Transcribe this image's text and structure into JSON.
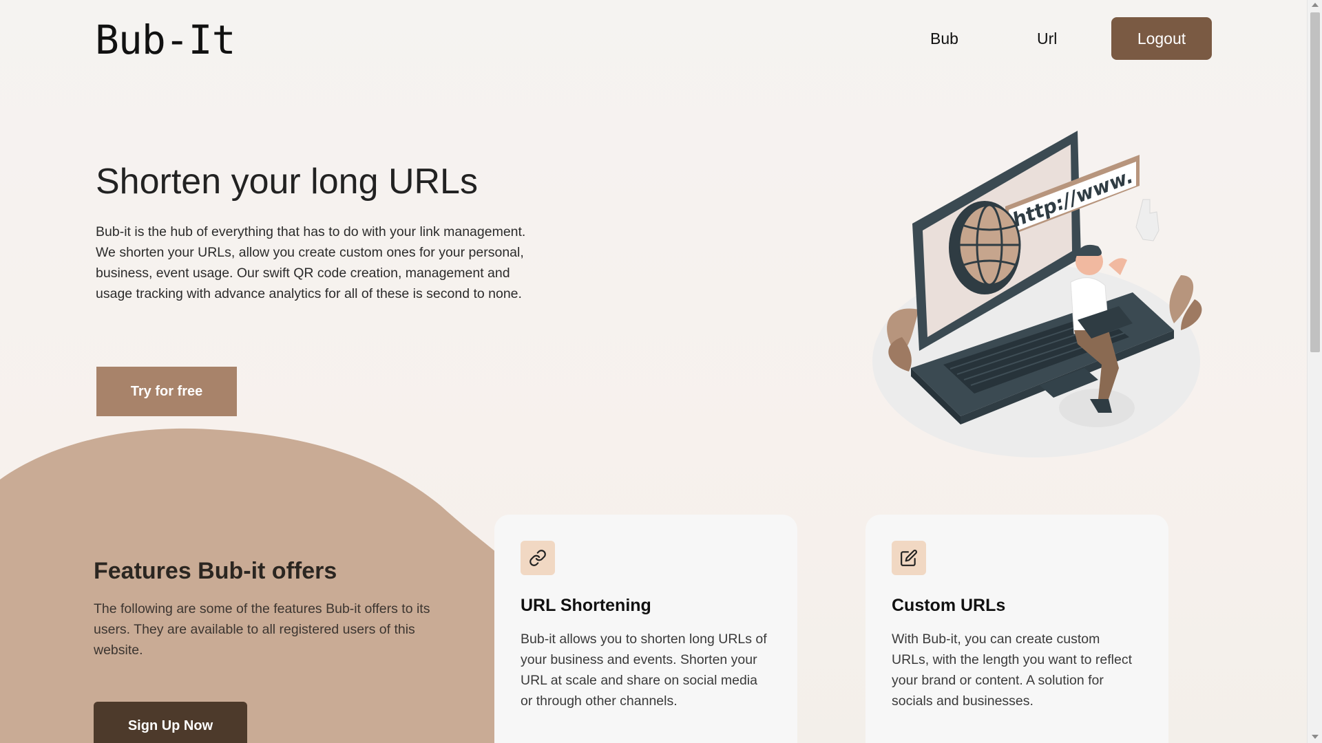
{
  "header": {
    "logo": "Bub-It",
    "nav": [
      {
        "label": "Bub"
      },
      {
        "label": "Url"
      }
    ],
    "logout_label": "Logout"
  },
  "hero": {
    "title": "Shorten your long URLs",
    "description": "Bub-it is the hub of everything that has to do with your link management. We shorten your URLs, allow you create custom ones for your personal, business, event usage. Our swift QR code creation, management and usage tracking with advance analytics for all of these is second to none.",
    "cta_label": "Try for free",
    "illustration_text": "http://www."
  },
  "features": {
    "title": "Features Bub-it offers",
    "description": "The following are some of the features Bub-it offers to its users. They are available to all registered users of this website.",
    "signup_label": "Sign Up Now",
    "cards": [
      {
        "icon": "link-icon",
        "title": "URL Shortening",
        "text": "Bub-it allows you to shorten long URLs of your business and events. Shorten your URL at scale and share on social media or through other channels."
      },
      {
        "icon": "edit-icon",
        "title": "Custom URLs",
        "text": "With Bub-it, you can create custom URLs, with the length you want to reflect your brand or content. A solution for socials and businesses."
      }
    ]
  },
  "colors": {
    "accent_dark": "#7a5a43",
    "accent_light": "#a8836a",
    "blob": "#c9ab95",
    "icon_bg": "#f1d8c3"
  }
}
